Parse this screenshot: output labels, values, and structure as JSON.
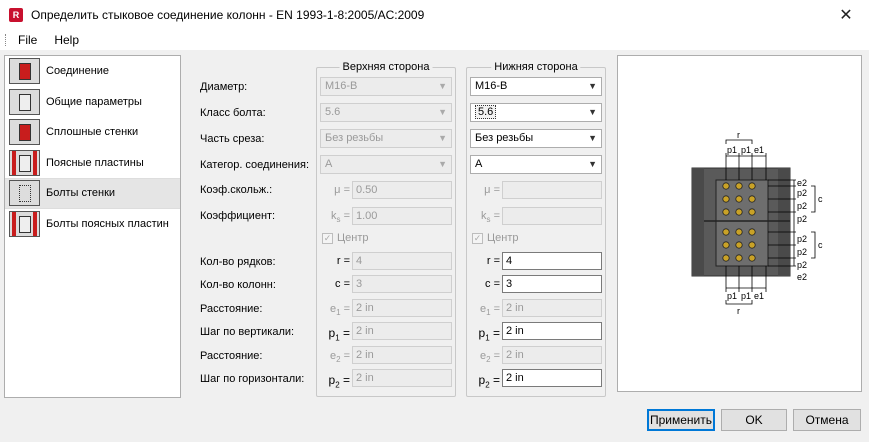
{
  "window": {
    "title": "Определить стыковое соединение колонн - EN 1993-1-8:2005/AC:2009",
    "icon_letter": "R"
  },
  "menu": [
    "File",
    "Help"
  ],
  "sidebar": {
    "items": [
      {
        "label": "Соединение",
        "icon": "connection-icon"
      },
      {
        "label": "Общие параметры",
        "icon": "general-parameters-icon"
      },
      {
        "label": "Сплошные стенки",
        "icon": "web-plates-icon"
      },
      {
        "label": "Поясные пластины",
        "icon": "flange-plates-icon"
      },
      {
        "label": "Болты стенки",
        "icon": "web-bolts-icon"
      },
      {
        "label": "Болты поясных пластин",
        "icon": "flange-bolts-icon"
      }
    ],
    "selected_index": 4
  },
  "form": {
    "upper_title": "Верхняя сторона",
    "lower_title": "Нижняя сторона",
    "labels": {
      "diameter": "Диаметр:",
      "bolt_class": "Класс болта:",
      "shear_part": "Часть среза:",
      "category": "Категор. соединения:",
      "friction": "Коэф.скольж.:",
      "coefficient": "Коэффициент:",
      "rows": "Кол-во рядков:",
      "columns": "Кол-во колонн:",
      "distance1": "Расстояние:",
      "vert_step": "Шаг по вертикали:",
      "distance2": "Расстояние:",
      "horiz_step": "Шаг по горизонтали:"
    },
    "symbols": {
      "mu": "μ =",
      "k": "k",
      "k_sub": "s",
      "r": "r =",
      "c": "c =",
      "e": "e",
      "e1_sub": "1",
      "e2_sub": "2",
      "p": "p",
      "p1_sub": "1",
      "p2_sub": "2",
      "eq": " ="
    },
    "center_label": "Центр",
    "upper": {
      "diameter": "M16-B",
      "bolt_class": "5.6",
      "shear_part": "Без резьбы",
      "category": "A",
      "mu": "0.50",
      "ks": "1.00",
      "r": "4",
      "c": "3",
      "e1": "2 in",
      "p1": "2 in",
      "e2": "2 in",
      "p2": "2 in"
    },
    "lower": {
      "diameter": "M16-B",
      "bolt_class": "5.6",
      "shear_part": "Без резьбы",
      "category": "A",
      "mu": "",
      "ks": "",
      "r": "4",
      "c": "3",
      "e1": "2 in",
      "p1": "2 in",
      "e2": "2 in",
      "p2": "2 in"
    }
  },
  "preview": {
    "top_labels": {
      "r": "r",
      "p1a": "p1",
      "p1b": "p1",
      "e1": "e1"
    },
    "bottom_labels": {
      "r": "r",
      "p1a": "p1",
      "p1b": "p1",
      "e1": "e1"
    },
    "right_labels_top": [
      "e2",
      "p2",
      "p2",
      "p2"
    ],
    "right_labels_bottom": [
      "p2",
      "p2",
      "p2",
      "e2"
    ],
    "c_label": "c"
  },
  "buttons": {
    "apply": "Применить",
    "ok": "OK",
    "cancel": "Отмена"
  }
}
